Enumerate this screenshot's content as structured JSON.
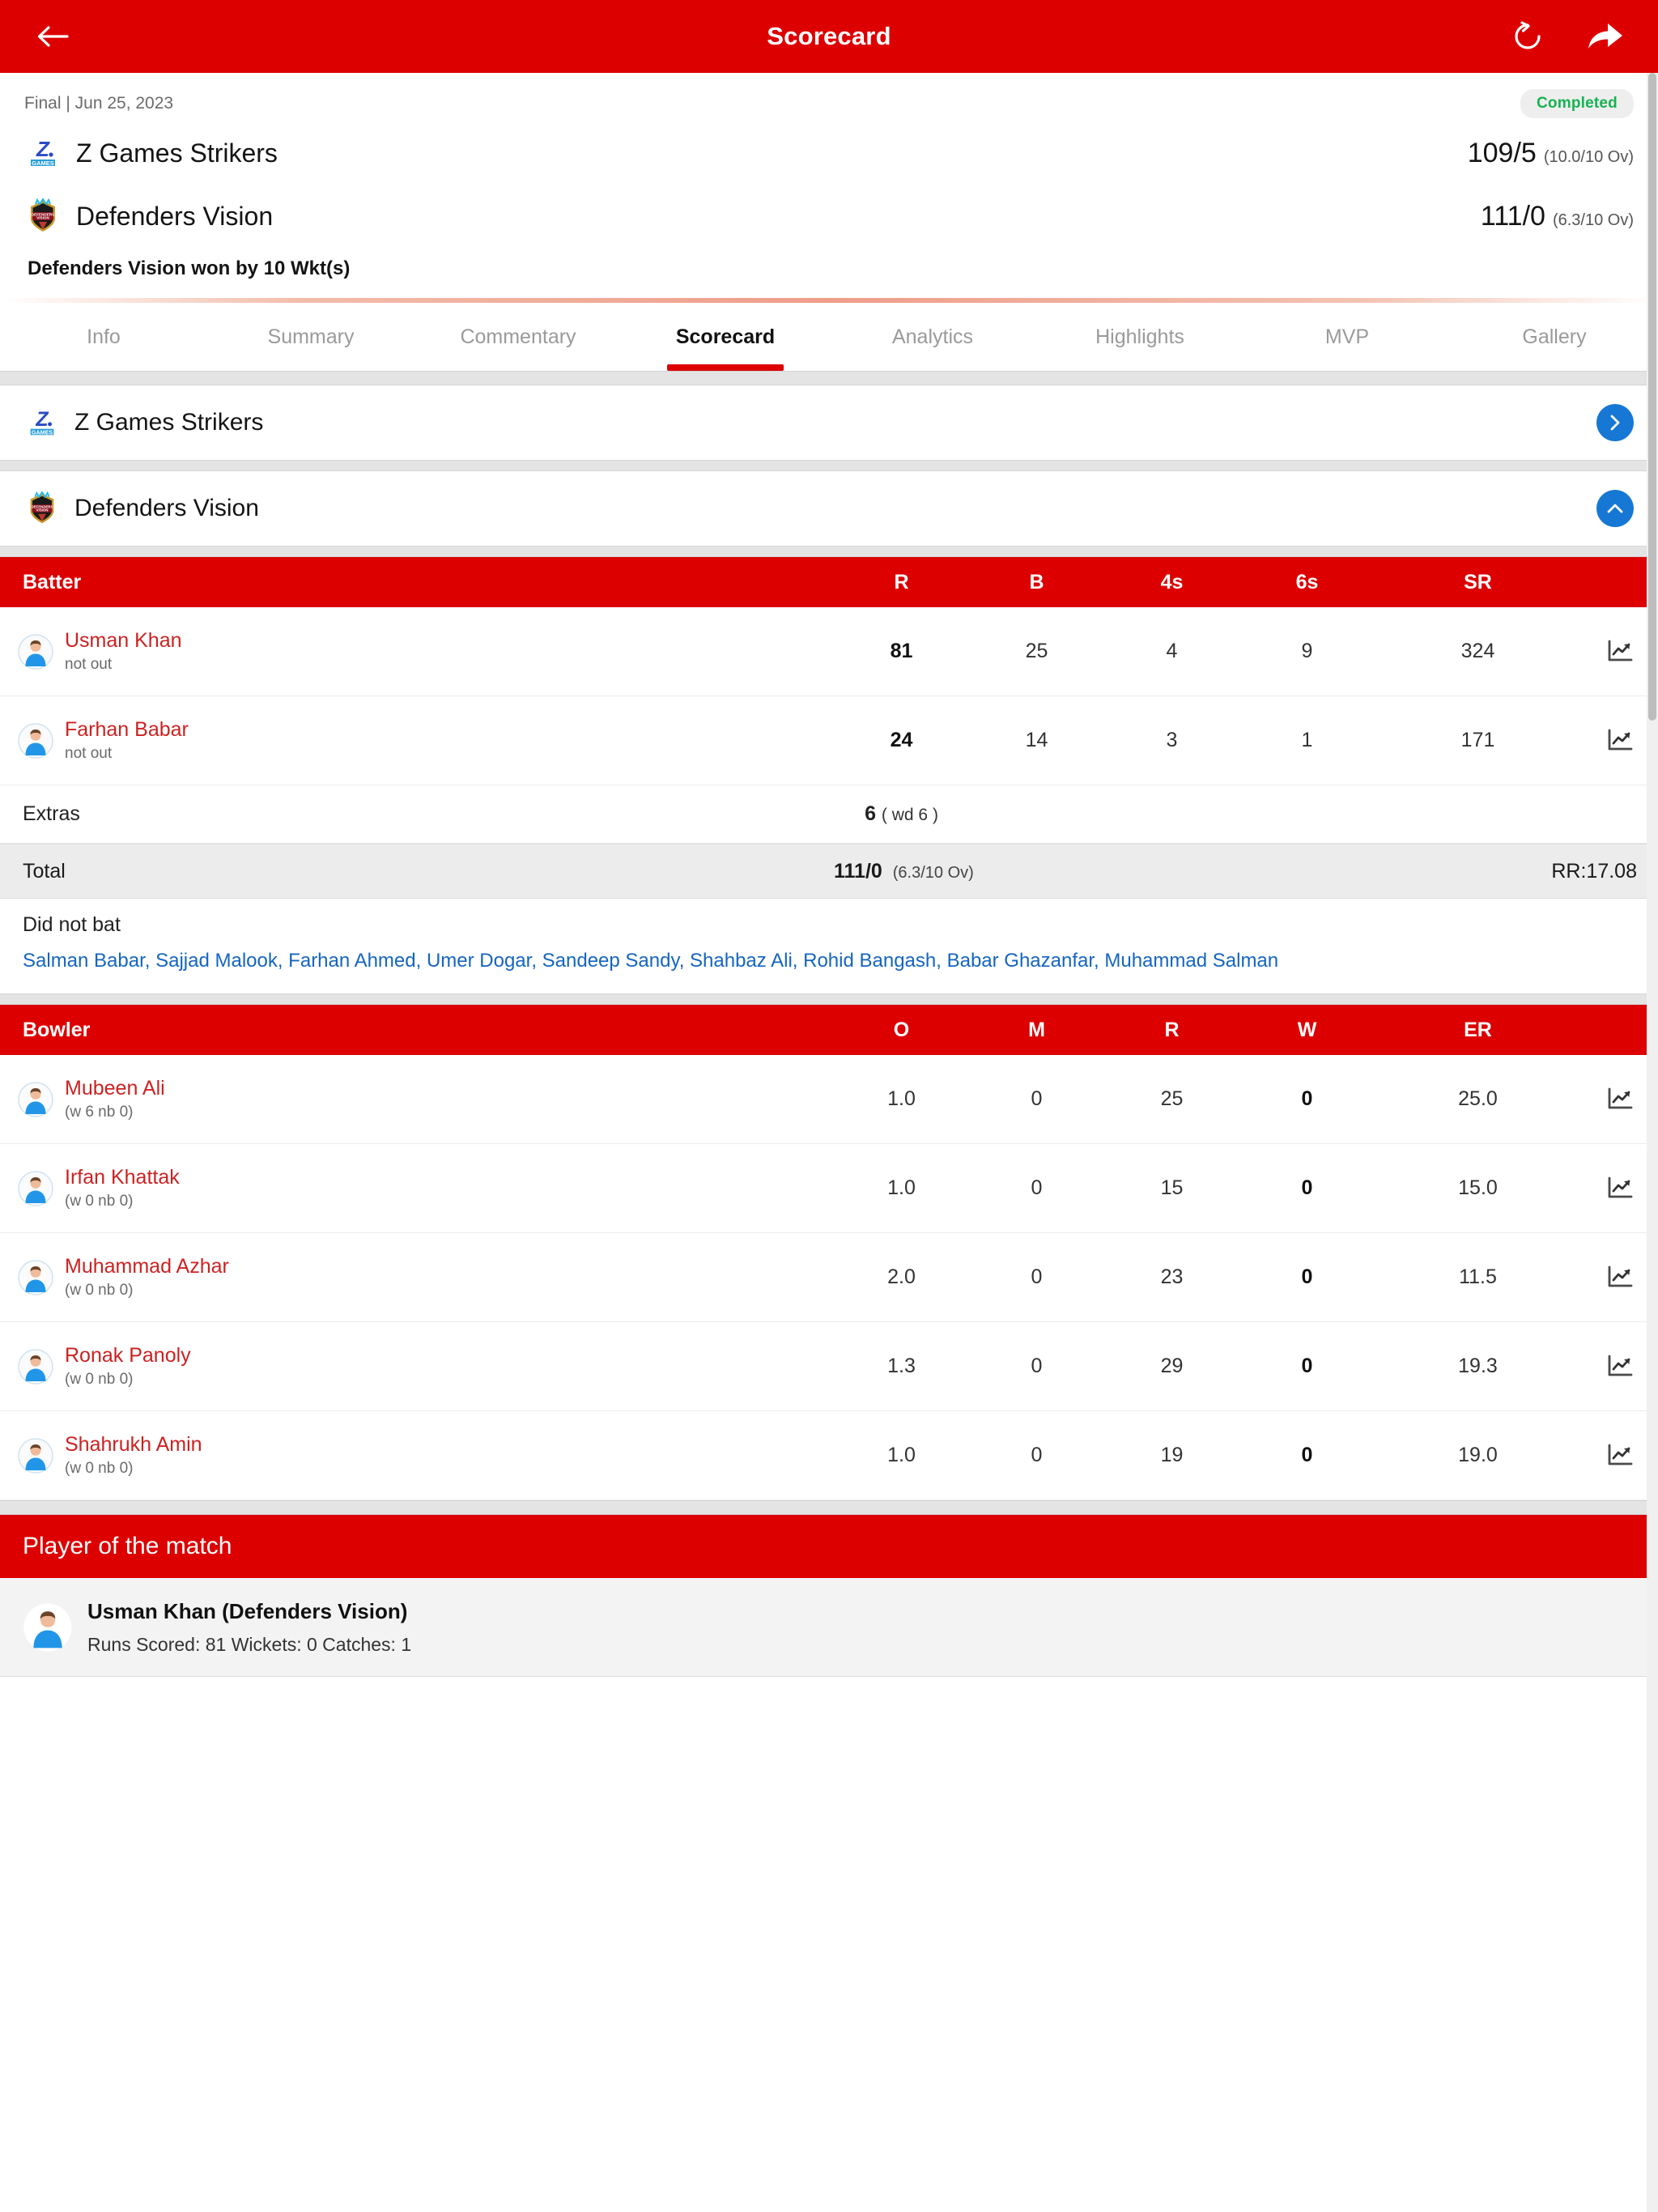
{
  "appbar": {
    "title": "Scorecard",
    "back_icon": "back-arrow-icon",
    "refresh_icon": "refresh-icon",
    "share_icon": "share-icon"
  },
  "match": {
    "meta": "Final | Jun 25, 2023",
    "status_badge": "Completed",
    "teams": [
      {
        "name": "Z Games Strikers",
        "score": "109/5",
        "overs": "(10.0/10 Ov)",
        "logo": "z-games-strikers-logo"
      },
      {
        "name": "Defenders Vision",
        "score": "111/0",
        "overs": "(6.3/10 Ov)",
        "logo": "defenders-vision-logo"
      }
    ],
    "result": "Defenders Vision won by 10 Wkt(s)"
  },
  "tabs": [
    {
      "label": "Info",
      "active": false
    },
    {
      "label": "Summary",
      "active": false
    },
    {
      "label": "Commentary",
      "active": false
    },
    {
      "label": "Scorecard",
      "active": true
    },
    {
      "label": "Analytics",
      "active": false
    },
    {
      "label": "Highlights",
      "active": false
    },
    {
      "label": "MVP",
      "active": false
    },
    {
      "label": "Gallery",
      "active": false
    }
  ],
  "innings": [
    {
      "team": "Z Games Strikers",
      "expanded": false,
      "chevron": "chevron-right-icon"
    },
    {
      "team": "Defenders Vision",
      "expanded": true,
      "chevron": "chevron-up-icon"
    }
  ],
  "batting": {
    "headers": {
      "name": "Batter",
      "r": "R",
      "b": "B",
      "fours": "4s",
      "sixes": "6s",
      "sr": "SR"
    },
    "rows": [
      {
        "name": "Usman Khan",
        "status": "not out",
        "r": "81",
        "b": "25",
        "fours": "4",
        "sixes": "9",
        "sr": "324"
      },
      {
        "name": "Farhan Babar",
        "status": "not out",
        "r": "24",
        "b": "14",
        "fours": "3",
        "sixes": "1",
        "sr": "171"
      }
    ],
    "extras_label": "Extras",
    "extras_value": "6",
    "extras_detail": "( wd 6 )",
    "total_label": "Total",
    "total_value": "111/0",
    "total_overs": "(6.3/10 Ov)",
    "run_rate": "RR:17.08",
    "did_not_bat_label": "Did not bat",
    "did_not_bat": "Salman Babar, Sajjad Malook, Farhan Ahmed, Umer Dogar, Sandeep Sandy, Shahbaz Ali, Rohid Bangash, Babar Ghazanfar, Muhammad Salman"
  },
  "bowling": {
    "headers": {
      "name": "Bowler",
      "o": "O",
      "m": "M",
      "r": "R",
      "w": "W",
      "er": "ER"
    },
    "rows": [
      {
        "name": "Mubeen Ali",
        "extras": "(w 6 nb 0)",
        "o": "1.0",
        "m": "0",
        "r": "25",
        "w": "0",
        "er": "25.0"
      },
      {
        "name": "Irfan Khattak",
        "extras": "(w 0 nb 0)",
        "o": "1.0",
        "m": "0",
        "r": "15",
        "w": "0",
        "er": "15.0"
      },
      {
        "name": "Muhammad Azhar",
        "extras": "(w 0 nb 0)",
        "o": "2.0",
        "m": "0",
        "r": "23",
        "w": "0",
        "er": "11.5"
      },
      {
        "name": "Ronak Panoly",
        "extras": "(w 0 nb 0)",
        "o": "1.3",
        "m": "0",
        "r": "29",
        "w": "0",
        "er": "19.3"
      },
      {
        "name": "Shahrukh Amin",
        "extras": "(w 0 nb 0)",
        "o": "1.0",
        "m": "0",
        "r": "19",
        "w": "0",
        "er": "19.0"
      }
    ]
  },
  "player_of_match": {
    "heading": "Player of the match",
    "name": "Usman Khan (Defenders Vision)",
    "stats": "Runs Scored: 81   Wickets: 0   Catches: 1"
  },
  "colors": {
    "brand_red": "#dd0000",
    "accent_blue": "#1678d4",
    "player_link": "#cc2222",
    "link_blue": "#1565c0",
    "status_green": "#16b351"
  }
}
